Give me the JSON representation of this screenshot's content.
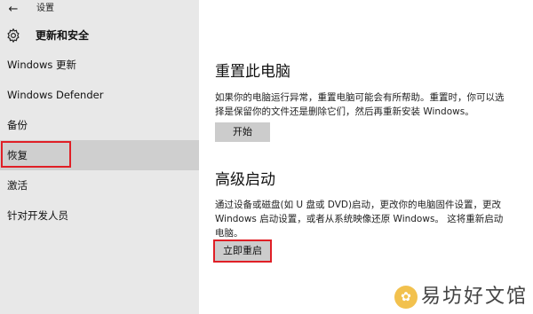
{
  "window": {
    "back_glyph": "←",
    "title": "设置"
  },
  "header": {
    "icon": "gear-icon",
    "title": "更新和安全"
  },
  "sidebar": {
    "items": [
      {
        "label": "Windows 更新",
        "selected": false
      },
      {
        "label": "Windows Defender",
        "selected": false
      },
      {
        "label": "备份",
        "selected": false
      },
      {
        "label": "恢复",
        "selected": true
      },
      {
        "label": "激活",
        "selected": false
      },
      {
        "label": "针对开发人员",
        "selected": false
      }
    ]
  },
  "main": {
    "reset": {
      "heading": "重置此电脑",
      "description": "如果你的电脑运行异常，重置电脑可能会有所帮助。重置时，你可以选择是保留你的文件还是删除它们，然后再重新安装 Windows。",
      "button_label": "开始"
    },
    "advanced": {
      "heading": "高级启动",
      "description": "通过设备或磁盘(如 U 盘或 DVD)启动，更改你的电脑固件设置，更改 Windows 启动设置，或者从系统映像还原 Windows。 这将重新启动电脑。",
      "button_label": "立即重启"
    }
  },
  "watermark": {
    "text": "易坊好文馆"
  },
  "colors": {
    "sidebar_bg": "#e8e8e8",
    "selected_bg": "#cfcfcf",
    "highlight": "#e01f26",
    "button_bg": "#cccccc"
  }
}
